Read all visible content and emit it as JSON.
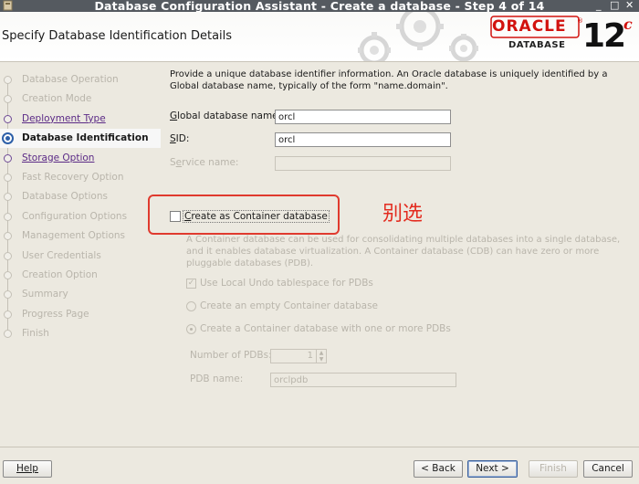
{
  "window": {
    "title": "Database Configuration Assistant - Create a database - Step 4 of 14",
    "minimize": "_",
    "maximize": "□",
    "close": "✕"
  },
  "header": {
    "title": "Specify Database Identification Details",
    "logo_oracle": "ORACLE",
    "logo_reg": "®",
    "logo_database": "DATABASE",
    "logo_version": "12",
    "logo_version_suffix": "c"
  },
  "nav": {
    "items": [
      {
        "label": "Database Operation",
        "state": "disabled"
      },
      {
        "label": "Creation Mode",
        "state": "disabled"
      },
      {
        "label": "Deployment Type",
        "state": "link"
      },
      {
        "label": "Database Identification",
        "state": "active"
      },
      {
        "label": "Storage Option",
        "state": "link"
      },
      {
        "label": "Fast Recovery Option",
        "state": "disabled"
      },
      {
        "label": "Database Options",
        "state": "disabled"
      },
      {
        "label": "Configuration Options",
        "state": "disabled"
      },
      {
        "label": "Management Options",
        "state": "disabled"
      },
      {
        "label": "User Credentials",
        "state": "disabled"
      },
      {
        "label": "Creation Option",
        "state": "disabled"
      },
      {
        "label": "Summary",
        "state": "disabled"
      },
      {
        "label": "Progress Page",
        "state": "disabled"
      },
      {
        "label": "Finish",
        "state": "disabled"
      }
    ]
  },
  "form": {
    "description": "Provide a unique database identifier information. An Oracle database is uniquely identified by a Global database name, typically of the form \"name.domain\".",
    "global_db_label_rest": "lobal database name:",
    "global_db_label_key": "G",
    "global_db_value": "orcl",
    "sid_label_key": "S",
    "sid_label_rest": "ID:",
    "sid_value": "orcl",
    "service_label_first": "S",
    "service_label_key": "e",
    "service_label_rest": "rvice name:",
    "service_value": "",
    "cdb_label_key": "C",
    "cdb_label_rest": "reate as Container database",
    "cdb_checked": false,
    "annotation": "别选",
    "cdb_description": "A Container database can be used for consolidating multiple databases into a single database, and it enables database virtualization. A Container database (CDB) can have zero or more pluggable databases (PDB).",
    "local_undo_label": "Use Local Undo tablespace for PDBs",
    "local_undo_checked": true,
    "empty_cdb_label": "Create an empty Container database",
    "cdb_with_pdbs_label": "Create a Container database with one or more PDBs",
    "num_pdbs_label": "Number of PDBs:",
    "num_pdbs_value": "1",
    "pdb_name_label": "PDB name:",
    "pdb_name_value": "orclpdb"
  },
  "buttons": {
    "help": "Help",
    "back": "< Back",
    "next": "Next >",
    "finish": "Finish",
    "cancel": "Cancel"
  },
  "colors": {
    "oracle_red": "#d2120e",
    "annotation_red": "#e32b1f",
    "title_bar": "#555a60",
    "active_nav": "#2d5fa8"
  }
}
